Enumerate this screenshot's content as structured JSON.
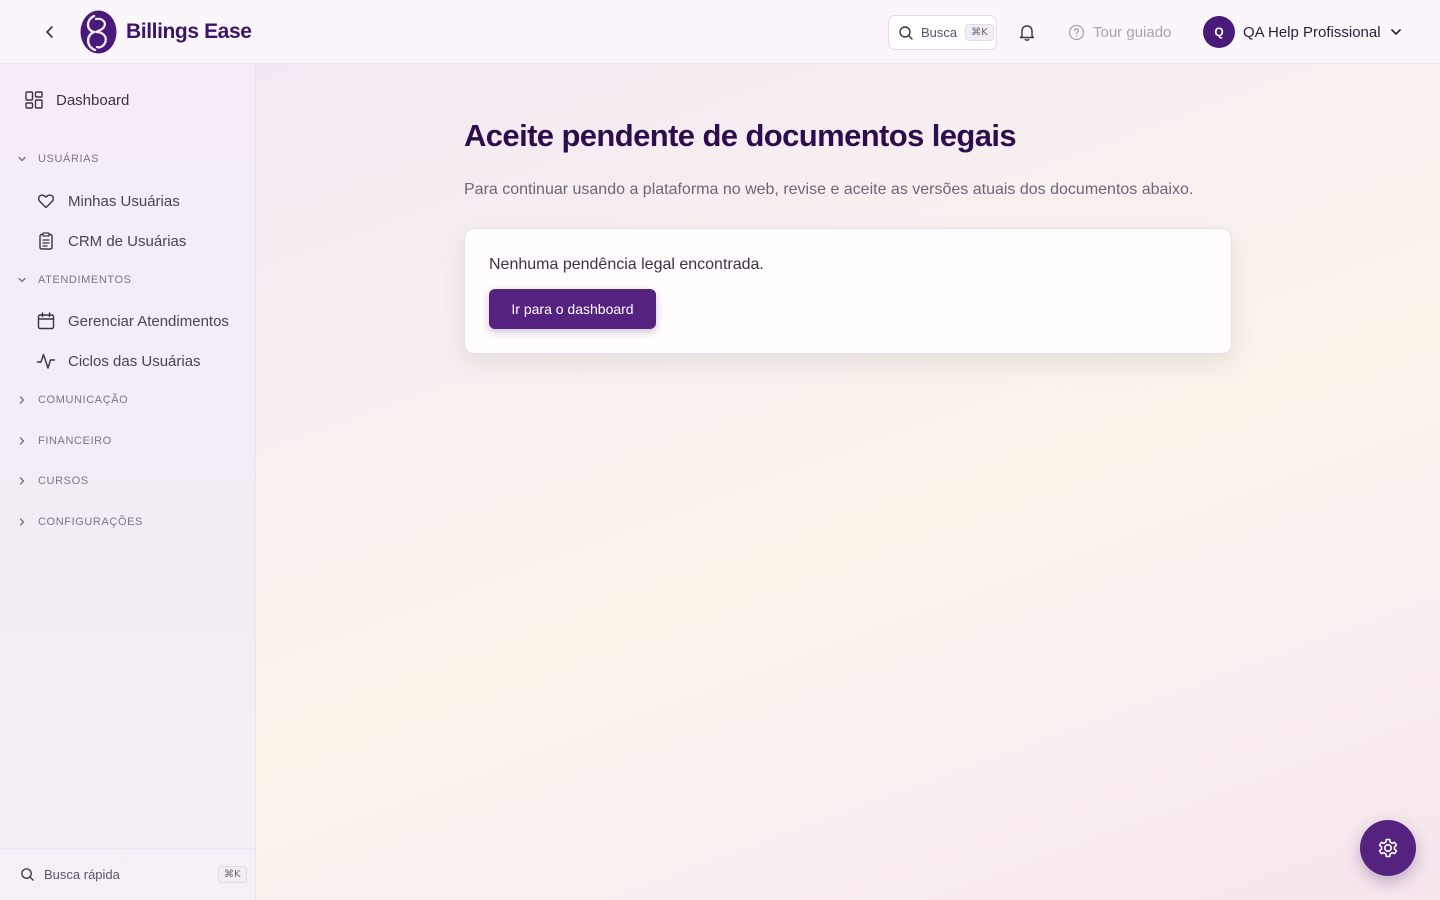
{
  "header": {
    "brand_name": "Billings Ease",
    "search_label": "Busca",
    "search_shortcut": "⌘K",
    "tour_label": "Tour guiado",
    "user_initial": "Q",
    "user_name": "QA Help Profissional"
  },
  "sidebar": {
    "dashboard_label": "Dashboard",
    "groups": [
      {
        "label": "USUÁRIAS",
        "expanded": true,
        "items": [
          {
            "label": "Minhas Usuárias",
            "icon": "heart-icon"
          },
          {
            "label": "CRM de Usuárias",
            "icon": "clipboard-icon"
          }
        ]
      },
      {
        "label": "ATENDIMENTOS",
        "expanded": true,
        "items": [
          {
            "label": "Gerenciar Atendimentos",
            "icon": "calendar-icon"
          },
          {
            "label": "Ciclos das Usuárias",
            "icon": "activity-icon"
          }
        ]
      },
      {
        "label": "COMUNICAÇÃO",
        "expanded": false,
        "items": []
      },
      {
        "label": "FINANCEIRO",
        "expanded": false,
        "items": []
      },
      {
        "label": "CURSOS",
        "expanded": false,
        "items": []
      },
      {
        "label": "CONFIGURAÇÕES",
        "expanded": false,
        "items": []
      }
    ],
    "quick_search_label": "Busca rápida",
    "quick_search_shortcut": "⌘K"
  },
  "main": {
    "title": "Aceite pendente de documentos legais",
    "subtitle": "Para continuar usando a plataforma no web, revise e aceite as versões atuais dos documentos abaixo.",
    "card_message": "Nenhuma pendência legal encontrada.",
    "cta_label": "Ir para o dashboard"
  },
  "colors": {
    "brand": "#3b1566",
    "primary_button": "#55227f",
    "title": "#2e0d4f"
  }
}
